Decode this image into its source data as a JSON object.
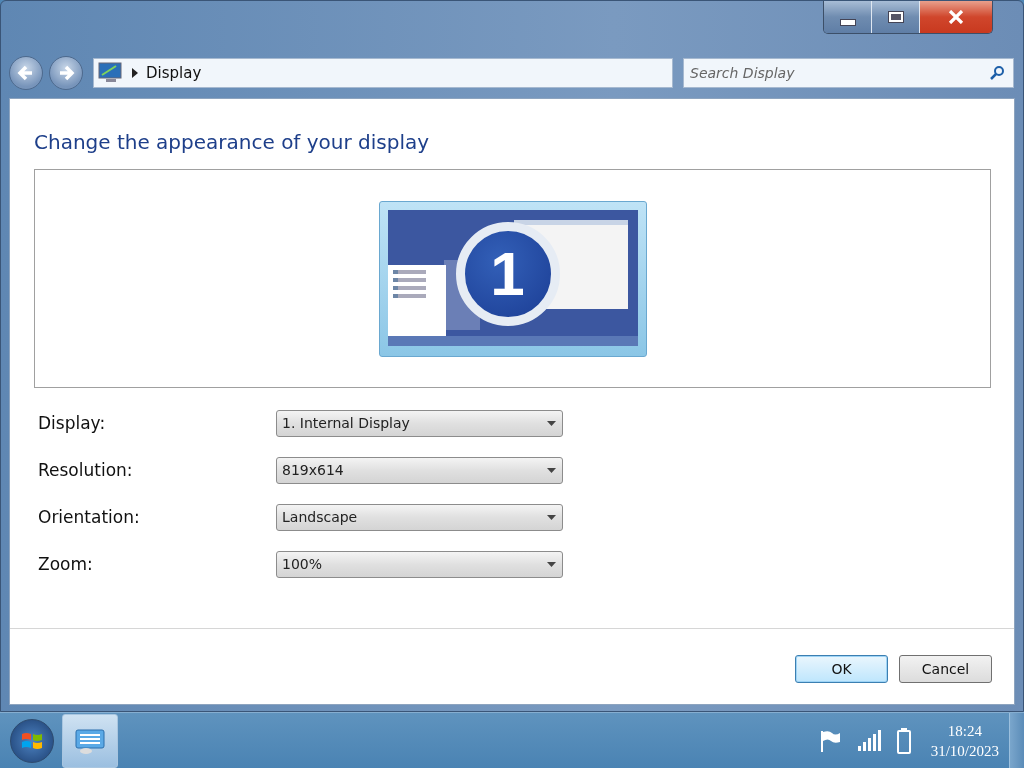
{
  "address_bar": {
    "path": "Display"
  },
  "search": {
    "placeholder": "Search Display"
  },
  "heading": "Change the appearance of your display",
  "preview": {
    "display_number": "1"
  },
  "settings": [
    {
      "label": "Display:",
      "value": "1. Internal Display"
    },
    {
      "label": "Resolution:",
      "value": "819x614"
    },
    {
      "label": "Orientation:",
      "value": "Landscape"
    },
    {
      "label": "Zoom:",
      "value": "100%"
    }
  ],
  "buttons": [
    {
      "label": "OK",
      "default": true
    },
    {
      "label": "Cancel",
      "default": false
    }
  ],
  "taskbar": {
    "time": "18:24",
    "date": "31/10/2023"
  }
}
